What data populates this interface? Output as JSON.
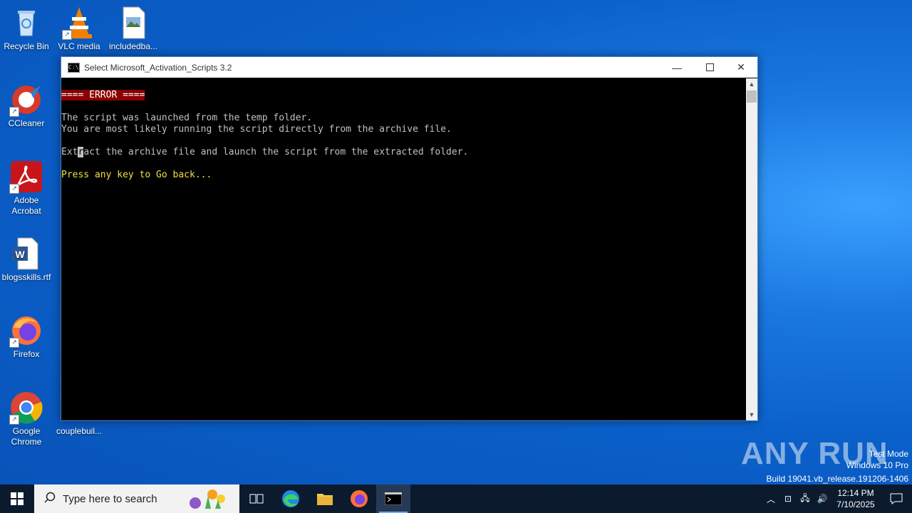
{
  "desktop": {
    "icons": [
      {
        "label": "Recycle Bin"
      },
      {
        "label": "VLC media"
      },
      {
        "label": "includedba..."
      },
      {
        "label": "CCleaner"
      },
      {
        "label": "Adobe Acrobat"
      },
      {
        "label": "blogsskills.rtf"
      },
      {
        "label": "Firefox"
      },
      {
        "label": "Google Chrome"
      },
      {
        "label": "couplebuil..."
      }
    ]
  },
  "window": {
    "title": "Select Microsoft_Activation_Scripts 3.2",
    "console": {
      "error_header": "==== ERROR ====",
      "line1": "The script was launched from the temp folder.",
      "line2": "You are most likely running the script directly from the archive file.",
      "line3_pre": "Ext",
      "line3_cursor": "r",
      "line3_post": "act the archive file and launch the script from the extracted folder.",
      "prompt": "Press any key to Go back..."
    }
  },
  "watermark": {
    "brand": "ANY RUN",
    "mode": "Test Mode",
    "os": "Windows 10 Pro",
    "build": "Build 19041.vb_release.191206-1406"
  },
  "taskbar": {
    "search_placeholder": "Type here to search",
    "time": "12:14 PM",
    "date": "7/10/2025"
  },
  "colors": {
    "error_bg": "#8b0000",
    "prompt": "#f0e040",
    "console_text": "#c0c0c0"
  }
}
